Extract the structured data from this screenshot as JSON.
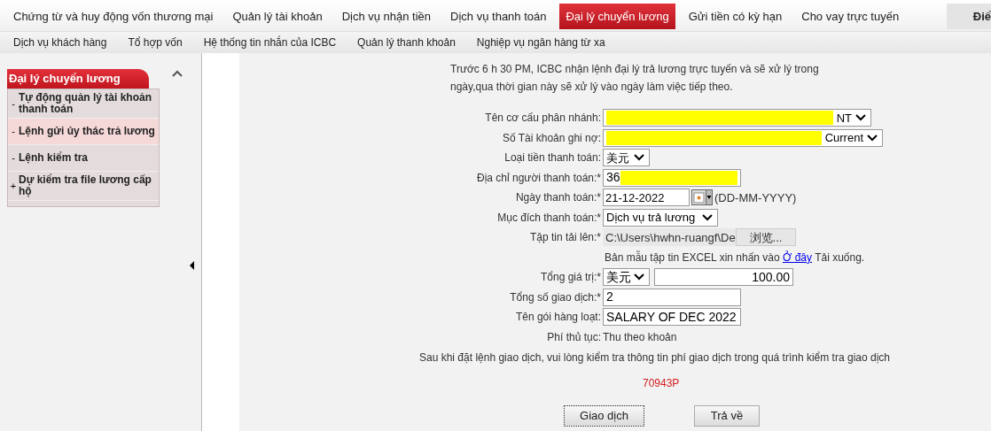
{
  "top_menu": [
    {
      "label": "Chứng từ và huy động vốn thương mại",
      "selected": false
    },
    {
      "label": "Quản lý tài khoản",
      "selected": false
    },
    {
      "label": "Dịch vụ nhận tiền",
      "selected": false
    },
    {
      "label": "Dịch vụ thanh toán",
      "selected": false
    },
    {
      "label": "Đại lý chuyển lương",
      "selected": true
    },
    {
      "label": "Gửi tiền có kỳ hạn",
      "selected": false
    },
    {
      "label": "Cho vay trực tuyến",
      "selected": false
    }
  ],
  "top_menu_edge": "Điể",
  "sub_menu": [
    "Dịch vụ khách hàng",
    "Tổ hợp vốn",
    "Hệ thống tin nhắn của ICBC",
    "Quản lý thanh khoản",
    "Nghiệp vụ ngân hàng từ xa"
  ],
  "sidebar": {
    "title": "Đại lý chuyển lương",
    "items": [
      {
        "marker": "-",
        "label": "Tự động quản lý tài khoản thanh toán",
        "selected": false
      },
      {
        "marker": "-",
        "label": "Lệnh gửi ủy thác trả lương",
        "selected": true
      },
      {
        "marker": "-",
        "label": "Lệnh kiểm tra",
        "selected": false
      },
      {
        "marker": "+",
        "label": "Dự kiểm tra file lương cấp hộ",
        "selected": false
      }
    ]
  },
  "notice": "Trước 6 h 30 PM, ICBC nhận lệnh đại lý trả lương trực tuyến và sẽ xử lý trong ngày,qua thời gian này sẽ xử lý vào ngày làm việc tiếp theo.",
  "form": [
    {
      "kind": "select",
      "label": "Tên cơ cấu phân nhánh:",
      "value": "NT",
      "redacted": true
    },
    {
      "kind": "select",
      "label": "Số Tài khoản ghi nợ:",
      "value": "Current",
      "redacted": true
    },
    {
      "kind": "select",
      "label": "Loại tiền thanh toán:",
      "value": "美元"
    },
    {
      "kind": "text",
      "label": "Địa chỉ người thanh toán:*",
      "value": "36",
      "redacted": true
    },
    {
      "kind": "date",
      "label": "Ngày thanh toán:*",
      "value": "21-12-2022",
      "hint": "(DD-MM-YYYY)"
    },
    {
      "kind": "select",
      "label": "Mục đích thanh toán:*",
      "value": "Dịch vụ trả lương"
    },
    {
      "kind": "file",
      "label": "Tập tin tải lên:*",
      "value": "C:\\Users\\hwhn-ruangf\\De",
      "button": "浏览..."
    },
    {
      "kind": "template_note",
      "before": "Bản mẫu tập tin EXCEL xin nhấn vào",
      "link": "Ở đây",
      "after": "Tải xuống."
    },
    {
      "kind": "amount",
      "label": "Tổng giá trị:*",
      "currency": "美元",
      "value": "100.00"
    },
    {
      "kind": "text",
      "label": "Tổng số giao dịch:*",
      "value": "2"
    },
    {
      "kind": "text",
      "label": "Tên gói hàng loạt:",
      "value": "SALARY OF DEC 2022"
    },
    {
      "kind": "static",
      "label": "Phí thủ tục:",
      "value": "Thu theo khoản"
    }
  ],
  "fee_notice": "Sau khi đặt lệnh giao dịch, vui lòng kiểm tra thông tin phí giao dịch trong quá trình kiểm tra giao dịch",
  "code": "70943P",
  "buttons": [
    "Giao dịch",
    "Trả về"
  ]
}
